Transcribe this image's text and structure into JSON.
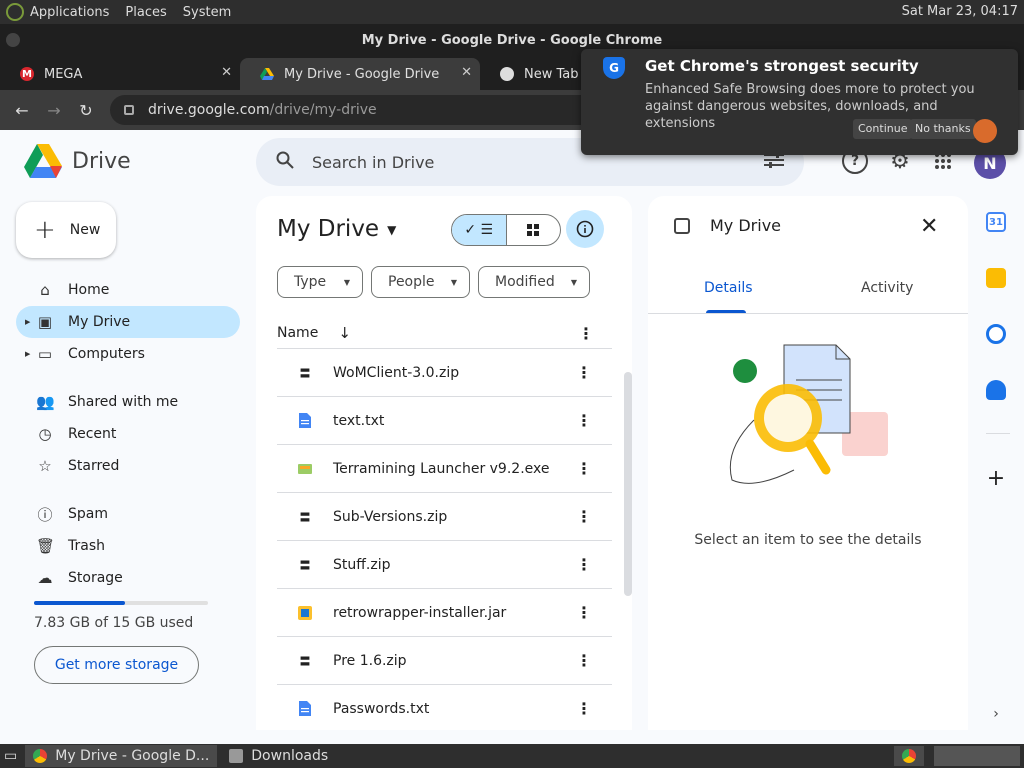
{
  "os": {
    "menus": [
      "Applications",
      "Places",
      "System"
    ],
    "clock": "Sat Mar 23, 04:17"
  },
  "window": {
    "title": "My Drive - Google Drive - Google Chrome"
  },
  "tabs": [
    {
      "label": "MEGA",
      "icon": "mega-icon",
      "active": false
    },
    {
      "label": "My Drive - Google Drive",
      "icon": "drive-icon",
      "active": true
    },
    {
      "label": "New Tab",
      "icon": "chrome-icon",
      "active": false
    }
  ],
  "url": {
    "host": "drive.google.com",
    "path": "/drive/my-drive"
  },
  "popup": {
    "title": "Get Chrome's strongest security",
    "text": "Enhanced Safe Browsing does more to protect you against dangerous websites, downloads, and extensions",
    "continue": "Continue",
    "no_thanks": "No thanks"
  },
  "drive": {
    "app_name": "Drive",
    "search_placeholder": "Search in Drive",
    "user_initial": "N",
    "new_button": "New"
  },
  "sidebar": {
    "items": [
      {
        "label": "Home",
        "icon": "home-icon"
      },
      {
        "label": "My Drive",
        "icon": "my-drive-icon",
        "active": true
      },
      {
        "label": "Computers",
        "icon": "computer-icon"
      },
      {
        "label": "Shared with me",
        "icon": "people-icon"
      },
      {
        "label": "Recent",
        "icon": "clock-icon"
      },
      {
        "label": "Starred",
        "icon": "star-icon"
      },
      {
        "label": "Spam",
        "icon": "spam-icon"
      },
      {
        "label": "Trash",
        "icon": "trash-icon"
      },
      {
        "label": "Storage",
        "icon": "cloud-icon"
      }
    ],
    "storage_text": "7.83 GB of 15 GB used",
    "storage_used_fraction": 0.522,
    "get_storage": "Get more storage"
  },
  "main": {
    "title": "My Drive",
    "filters": [
      "Type",
      "People",
      "Modified"
    ],
    "column_name": "Name",
    "files": [
      {
        "name": "WoMClient-3.0.zip",
        "type": "zip"
      },
      {
        "name": "text.txt",
        "type": "doc"
      },
      {
        "name": "Terramining Launcher v9.2.exe",
        "type": "exe"
      },
      {
        "name": "Sub-Versions.zip",
        "type": "zip"
      },
      {
        "name": "Stuff.zip",
        "type": "zip"
      },
      {
        "name": "retrowrapper-installer.jar",
        "type": "jar"
      },
      {
        "name": "Pre 1.6.zip",
        "type": "zip"
      },
      {
        "name": "Passwords.txt",
        "type": "doc"
      }
    ]
  },
  "details": {
    "title": "My Drive",
    "tabs": [
      "Details",
      "Activity"
    ],
    "message": "Select an item to see the details"
  },
  "taskbar": {
    "items": [
      {
        "label": "My Drive - Google D...",
        "icon": "chrome-icon",
        "active": true
      },
      {
        "label": "Downloads",
        "icon": "folder-icon",
        "active": false
      }
    ]
  },
  "colors": {
    "accent": "#0b57d0",
    "selected": "#c2e7ff",
    "surface": "#f8fafd"
  }
}
